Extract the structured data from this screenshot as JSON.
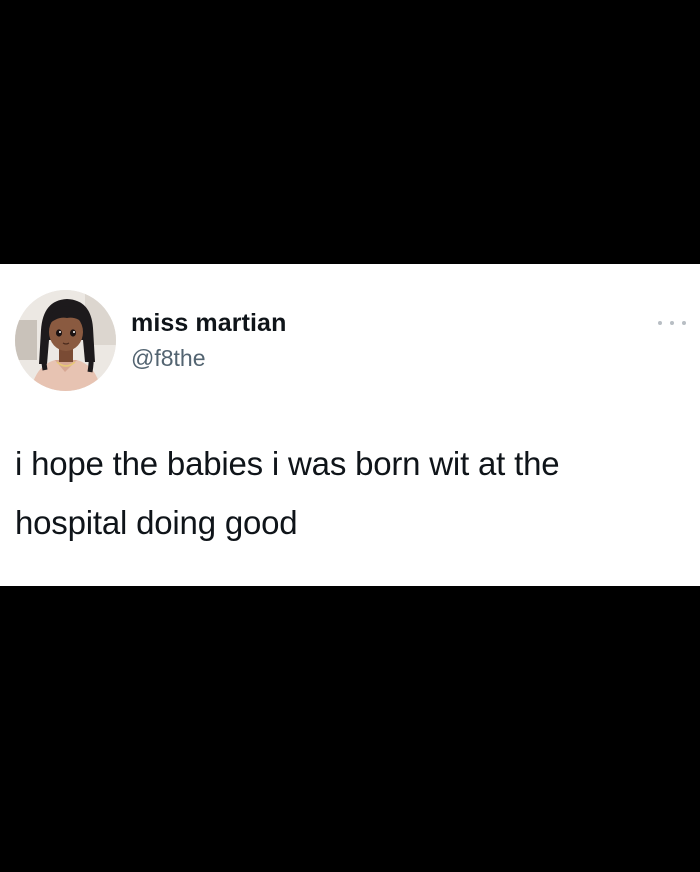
{
  "tweet": {
    "display_name": "miss martian",
    "handle": "@f8the",
    "text": "i hope the babies i was born wit at the hospital doing good",
    "more_icon": "more-horizontal-icon",
    "avatar_icon": "anime-girl-avatar"
  },
  "colors": {
    "background": "#000000",
    "card": "#ffffff",
    "text_primary": "#0f1419",
    "text_secondary": "#536471"
  }
}
